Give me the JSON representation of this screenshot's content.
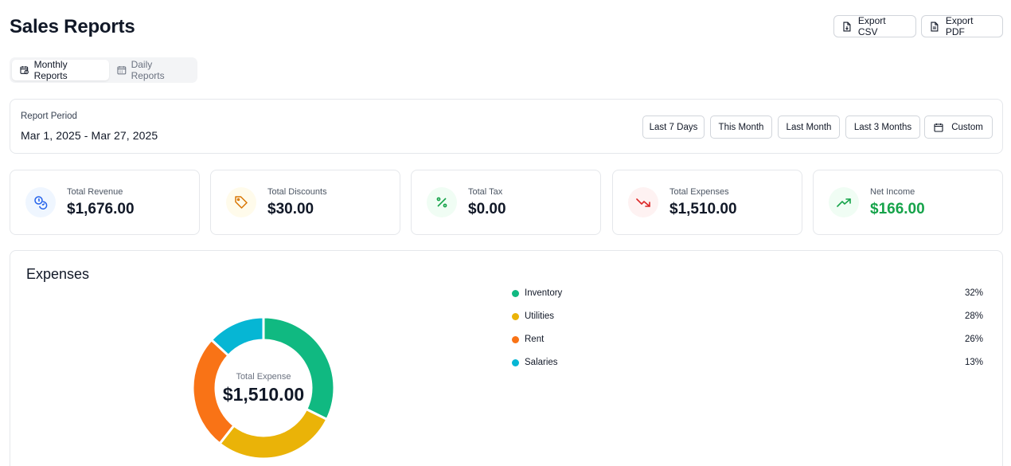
{
  "header": {
    "title": "Sales Reports",
    "export_csv": "Export CSV",
    "export_pdf": "Export PDF"
  },
  "tabs": [
    {
      "label": "Monthly Reports",
      "active": true
    },
    {
      "label": "Daily Reports",
      "active": false
    }
  ],
  "period": {
    "label": "Report Period",
    "value": "Mar 1, 2025 - Mar 27, 2025",
    "ranges": [
      "Last 7 Days",
      "This Month",
      "Last Month",
      "Last 3 Months",
      "Custom"
    ]
  },
  "stats": [
    {
      "label": "Total Revenue",
      "value": "$1,676.00",
      "icon": "coins-icon",
      "color": "#2563eb",
      "bg": "#eff6ff",
      "value_color": "#111827"
    },
    {
      "label": "Total Discounts",
      "value": "$30.00",
      "icon": "tag-icon",
      "color": "#d97706",
      "bg": "#fffbeb",
      "value_color": "#111827"
    },
    {
      "label": "Total Tax",
      "value": "$0.00",
      "icon": "percent-icon",
      "color": "#16a34a",
      "bg": "#f0fdf4",
      "value_color": "#111827"
    },
    {
      "label": "Total Expenses",
      "value": "$1,510.00",
      "icon": "trending-down-icon",
      "color": "#dc2626",
      "bg": "#fef2f2",
      "value_color": "#111827"
    },
    {
      "label": "Net Income",
      "value": "$166.00",
      "icon": "trending-up-icon",
      "color": "#16a34a",
      "bg": "#f0fdf4",
      "value_color": "#16a34a"
    }
  ],
  "expenses": {
    "title": "Expenses",
    "center_label": "Total Expense",
    "center_value": "$1,510.00"
  },
  "chart_data": {
    "type": "pie",
    "title": "Expenses",
    "categories": [
      "Inventory",
      "Utilities",
      "Rent",
      "Salaries"
    ],
    "values": [
      32,
      28,
      26,
      13
    ],
    "labels": [
      "32%",
      "28%",
      "26%",
      "13%"
    ],
    "colors": [
      "#10b981",
      "#eab308",
      "#f97316",
      "#06b6d4"
    ],
    "legend": "right"
  }
}
